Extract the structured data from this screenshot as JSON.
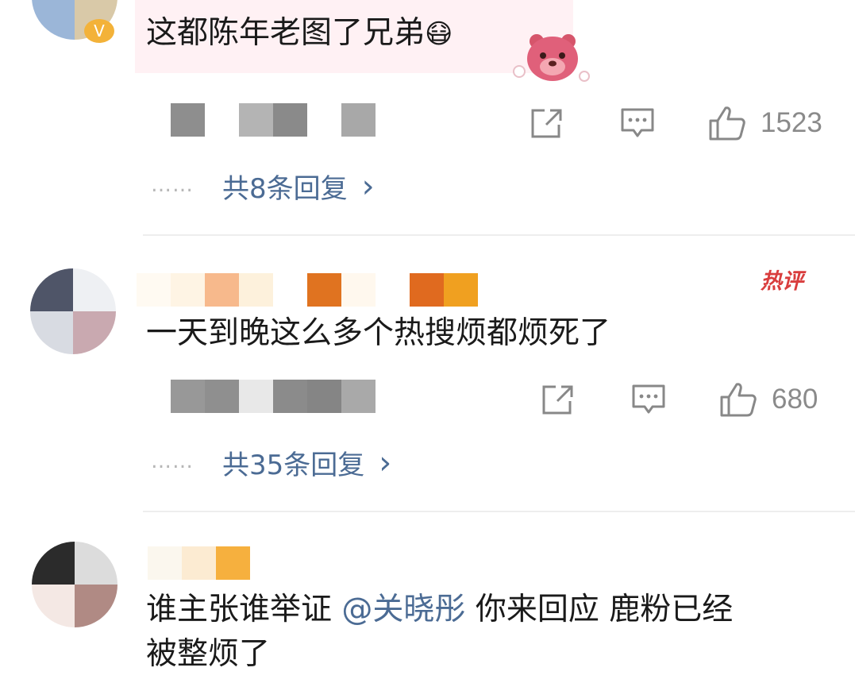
{
  "comments": [
    {
      "text": "这都陈年老图了兄弟",
      "emoji": "😷",
      "repost_icon": "share-icon",
      "comment_icon": "comment-icon",
      "like_icon": "thumbs-up-icon",
      "likes": "1523",
      "replies": "共8条回复",
      "replies_dots": "……",
      "replies_chevron": "›"
    },
    {
      "badge": "热评",
      "text": "一天到晚这么多个热搜烦都烦死了",
      "like_icon": "thumbs-up-icon",
      "likes": "680",
      "replies": "共35条回复",
      "replies_dots": "……",
      "replies_chevron": "›"
    },
    {
      "text_before": "谁主张谁举证 ",
      "mention": "@关晓彤",
      "text_after": " 你来回应 鹿粉已经",
      "text_line2": "被整烦了"
    }
  ],
  "colors": {
    "link": "#4b6b94",
    "count": "#8a8a8a",
    "badge": "#d93d3d",
    "bubble": "#fff1f4"
  }
}
